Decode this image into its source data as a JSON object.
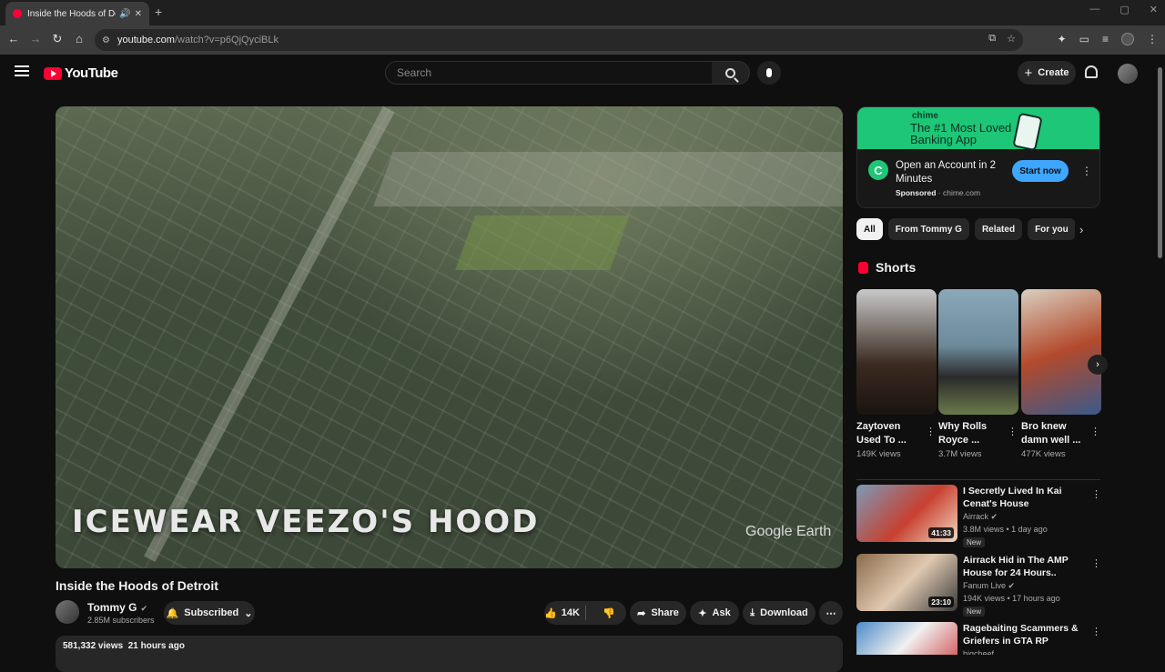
{
  "browser": {
    "tab_title": "Inside the Hoods of Detroit",
    "url_host": "youtube.com",
    "url_path": "/watch?v=p6QjQyciBLk"
  },
  "header": {
    "logo_text": "YouTube",
    "search_placeholder": "Search",
    "create_label": "Create"
  },
  "player": {
    "overlay_text": "ICEWEAR VEEZO'S HOOD",
    "watermark": "Google Earth"
  },
  "video": {
    "title": "Inside the Hoods of Detroit",
    "channel_name": "Tommy G",
    "subscribers": "2.85M subscribers",
    "subscribed_label": "Subscribed",
    "likes": "14K",
    "share_label": "Share",
    "ask_label": "Ask",
    "download_label": "Download",
    "views_time": "581,332 views  21 hours ago"
  },
  "ad": {
    "brand": "chime",
    "tagline": "The #1 Most Loved Banking App",
    "title": "Open an Account in 2 Minutes",
    "sponsored": "Sponsored",
    "domain": "chime.com",
    "cta": "Start now"
  },
  "chips": [
    "All",
    "From Tommy G",
    "Related",
    "For you"
  ],
  "shorts": {
    "heading": "Shorts",
    "items": [
      {
        "title": "Zaytoven Used To ...",
        "views": "149K views",
        "thumb_color": "#3a2a20"
      },
      {
        "title": "Why Rolls Royce ...",
        "views": "3.7M views",
        "thumb_color": "#6d8a9a"
      },
      {
        "title": "Bro knew damn well ...",
        "views": "477K views",
        "thumb_color": "#b34a2c"
      }
    ]
  },
  "recommended": [
    {
      "title": "I Secretly Lived In Kai Cenat's House",
      "channel": "Airrack",
      "meta": "3.8M views • 1 day ago",
      "badge": "New",
      "duration": "41:33",
      "thumb_color": "#7a9ab8"
    },
    {
      "title": "Airrack Hid in The AMP House for 24 Hours..",
      "channel": "Fanum Live",
      "meta": "194K views • 17 hours ago",
      "badge": "New",
      "duration": "23:10",
      "thumb_color": "#8a6a4a"
    },
    {
      "title": "Ragebaiting Scammers & Griefers in GTA RP",
      "channel": "bigcheef",
      "meta": "",
      "badge": "",
      "duration": "",
      "thumb_color": "#4a8ac8"
    }
  ]
}
